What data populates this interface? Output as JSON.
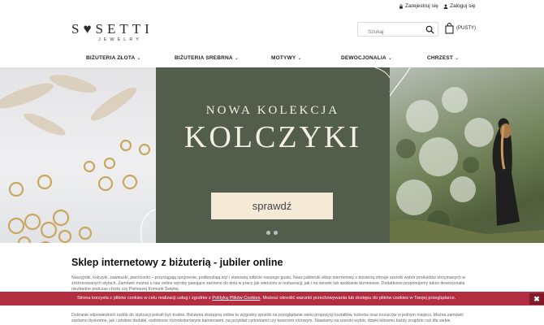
{
  "topbar": {
    "register": "Zarejestruj się",
    "login": "Zaloguj się"
  },
  "logo": {
    "name": "S♥SETTI",
    "sub": "JEWELRY"
  },
  "search": {
    "placeholder": "Szukaj"
  },
  "cart": {
    "label": "(PUSTY)"
  },
  "nav": {
    "items": [
      {
        "label": "BIŻUTERIA ZŁOTA"
      },
      {
        "label": "BIŻUTERIA SREBRNA"
      },
      {
        "label": "MOTYWY"
      },
      {
        "label": "DEWOCJONALIA"
      },
      {
        "label": "CHRZEST"
      }
    ]
  },
  "hero": {
    "subtitle": "NOWA KOLEKCJA",
    "title": "KOLCZYKI",
    "button": "sprawdź",
    "slides_total": 2,
    "active_slide": 1
  },
  "content": {
    "heading": "Sklep internetowy z biżuterią - jubiler online",
    "p1": "Naszyjniki, kolczyki, zawieszki, pierścionki – przyciągają spojrzenie, podkreślają styl i stanowią odbicie naszego gustu. Nasz jubilerski sklep internetowy z biżuterią oferuje szeroki wybór produktów utrzymanych w zróżnicowanych stylach. Zamówić można u nas online wyroby pasujące zarówno do dnia w pracy jak wieczoru w restauracji, jak i na wesele lub spotkanie biznesowe. Dodatkowo proponujemy także dewocjonalia niezbędne podczas chrztu czy Pierwszej Komunii Świętej.",
    "p2": "Dobranie odpowiednich ozdób do stylizacji potrafi być trudne. Biżuteria dostępna online to wygodny sposób na przeglądanie wielu propozycji kształtów, kolorów oraz kruszców w jednym miejscu. Można zamówić zarówno dyskretne, jak i zdobne dodatki, ozdobione różnokolorowymi kamieniami, na przykład cyrkoniami czy kwarcem różowym. Stawiamy na szeroki wybór, dzięki któremu każdy znajdzie coś dla siebie."
  },
  "cookie": {
    "text_before": "Strona korzysta z plików cookies w celu realizacji usług i zgodnie z ",
    "link": "Polityką Plików Cookies",
    "text_after": ". Możesz określić warunki przechowywania lub dostępu do plików cookies w Twojej przeglądarce.",
    "close": "✖"
  },
  "colors": {
    "hero_green": "#535d4b",
    "button_cream": "#f4ead7",
    "cookie_red": "#b22d3f"
  }
}
